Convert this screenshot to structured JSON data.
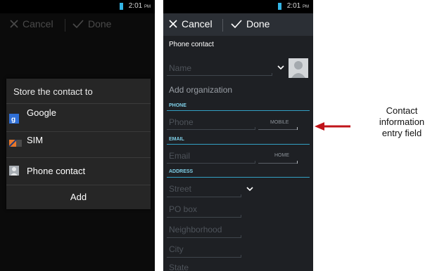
{
  "left_screen": {
    "status": {
      "time": "2:01",
      "ampm": "PM"
    },
    "actionbar": {
      "cancel": "Cancel",
      "done": "Done"
    },
    "dialog": {
      "title": "Store the contact to",
      "options": [
        {
          "label": "Google",
          "icon": "google-icon"
        },
        {
          "label": "SIM",
          "icon": "sim-icon"
        },
        {
          "label": "Phone contact",
          "icon": "phone-contact-icon"
        }
      ],
      "add": "Add"
    }
  },
  "right_screen": {
    "status": {
      "time": "2:01",
      "ampm": "PM"
    },
    "actionbar": {
      "cancel": "Cancel",
      "done": "Done"
    },
    "account": "Phone contact",
    "name_placeholder": "Name",
    "organization": "Add organization",
    "phone": {
      "header": "PHONE",
      "placeholder": "Phone",
      "type": "MOBILE"
    },
    "email": {
      "header": "EMAIL",
      "placeholder": "Email",
      "type": "HOME"
    },
    "address": {
      "header": "ADDRESS",
      "street": "Street",
      "pobox": "PO box",
      "neighborhood": "Neighborhood",
      "city": "City",
      "state": "State"
    }
  },
  "annotation": {
    "line1": "Contact",
    "line2": "information",
    "line3": "entry field",
    "arrow_color": "#c0141a"
  }
}
